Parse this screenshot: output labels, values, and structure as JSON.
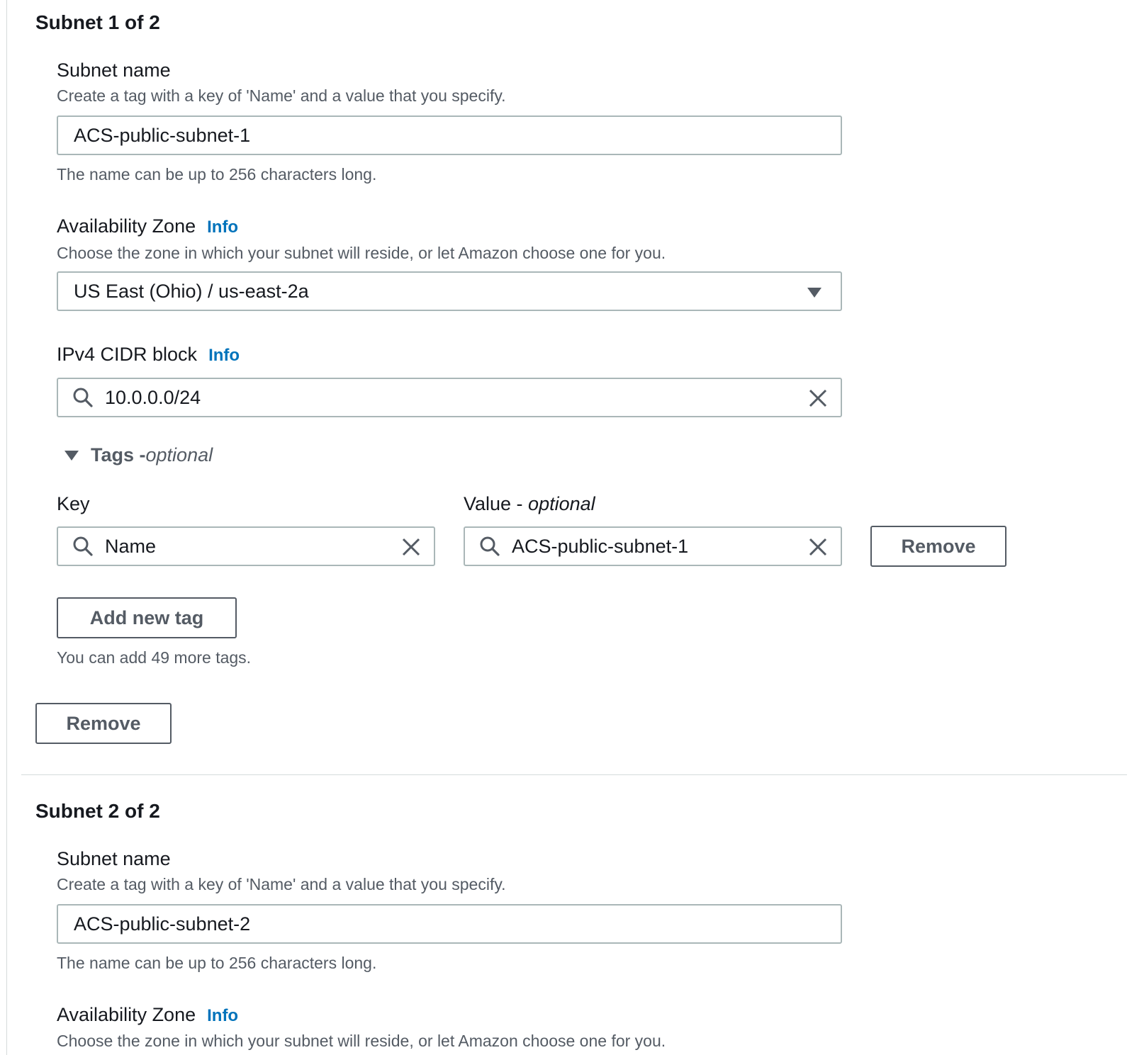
{
  "subnets": [
    {
      "title": "Subnet 1 of 2",
      "name_label": "Subnet name",
      "name_desc": "Create a tag with a key of 'Name' and a value that you specify.",
      "name_value": "ACS-public-subnet-1",
      "name_hint": "The name can be up to 256 characters long.",
      "az_label": "Availability Zone",
      "az_info": "Info",
      "az_desc": "Choose the zone in which your subnet will reside, or let Amazon choose one for you.",
      "az_value": "US East (Ohio) / us-east-2a",
      "cidr_label": "IPv4 CIDR block",
      "cidr_info": "Info",
      "cidr_value": "10.0.0.0/24",
      "tags_label": "Tags - ",
      "tags_optional": "optional",
      "key_label": "Key",
      "value_label": "Value - ",
      "value_optional": "optional",
      "tag_key": "Name",
      "tag_value": "ACS-public-subnet-1",
      "tag_remove_label": "Remove",
      "add_tag_label": "Add new tag",
      "tags_remaining": "You can add 49 more tags.",
      "remove_label": "Remove"
    },
    {
      "title": "Subnet 2 of 2",
      "name_label": "Subnet name",
      "name_desc": "Create a tag with a key of 'Name' and a value that you specify.",
      "name_value": "ACS-public-subnet-2",
      "name_hint": "The name can be up to 256 characters long.",
      "az_label": "Availability Zone",
      "az_info": "Info",
      "az_desc": "Choose the zone in which your subnet will reside, or let Amazon choose one for you."
    }
  ],
  "icons": {
    "search": "search-icon",
    "clear": "close-icon",
    "dropdown": "caret-down-icon",
    "expand": "caret-down-icon"
  },
  "colors": {
    "info_link": "#0073bb",
    "border": "#aab7b8",
    "button_border": "#545b64",
    "text": "#16191f",
    "secondary_text": "#545b64"
  }
}
